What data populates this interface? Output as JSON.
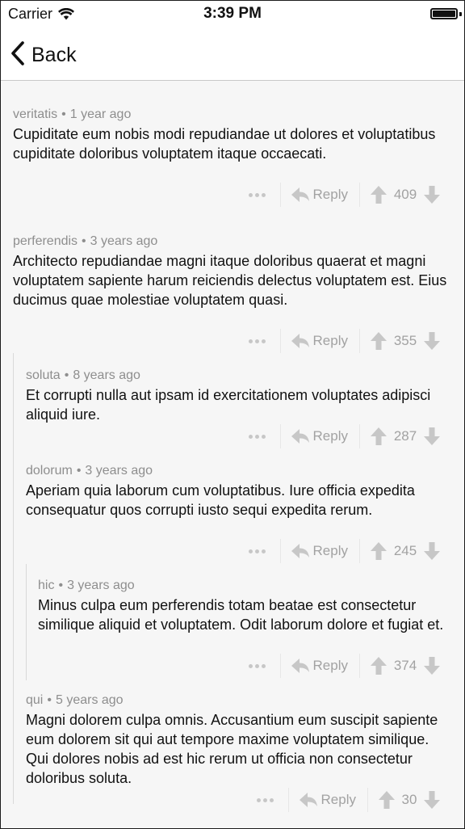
{
  "status_bar": {
    "carrier": "Carrier",
    "time": "3:39 PM"
  },
  "nav": {
    "back_label": "Back"
  },
  "actions": {
    "reply_label": "Reply",
    "more_icon": "ellipsis-icon",
    "reply_icon": "reply-arrow-icon",
    "upvote_icon": "arrow-up-icon",
    "downvote_icon": "arrow-down-icon"
  },
  "comments": [
    {
      "author": "veritatis",
      "separator": "•",
      "age": "1 year ago",
      "text": "Cupiditate eum nobis modi repudiandae ut dolores et voluptatibus cupiditate doloribus voluptatem itaque occaecati.",
      "score": "409",
      "depth": 0
    },
    {
      "author": "perferendis",
      "separator": "•",
      "age": "3 years ago",
      "text": "Architecto repudiandae magni itaque doloribus quaerat et magni voluptatem sapiente harum reiciendis delectus voluptatem est. Eius ducimus quae molestiae voluptatem quasi.",
      "score": "355",
      "depth": 0
    },
    {
      "author": "soluta",
      "separator": "•",
      "age": "8 years ago",
      "text": "Et corrupti nulla aut ipsam id exercitationem voluptates adipisci aliquid iure.",
      "score": "287",
      "depth": 1
    },
    {
      "author": "dolorum",
      "separator": "•",
      "age": "3 years ago",
      "text": "Aperiam quia laborum cum voluptatibus. Iure officia expedita consequatur quos corrupti iusto sequi expedita rerum.",
      "score": "245",
      "depth": 1
    },
    {
      "author": "hic",
      "separator": "•",
      "age": "3 years ago",
      "text": "Minus culpa eum perferendis totam beatae est consectetur similique aliquid et voluptatem. Odit laborum dolore et fugiat et.",
      "score": "374",
      "depth": 2
    },
    {
      "author": "qui",
      "separator": "•",
      "age": "5 years ago",
      "text": "Magni dolorem culpa omnis. Accusantium eum suscipit sapiente eum dolorem sit qui aut tempore maxime voluptatem similique. Qui dolores nobis ad est hic rerum ut officia non consectetur doloribus soluta.",
      "score": "30",
      "depth": 1
    }
  ]
}
